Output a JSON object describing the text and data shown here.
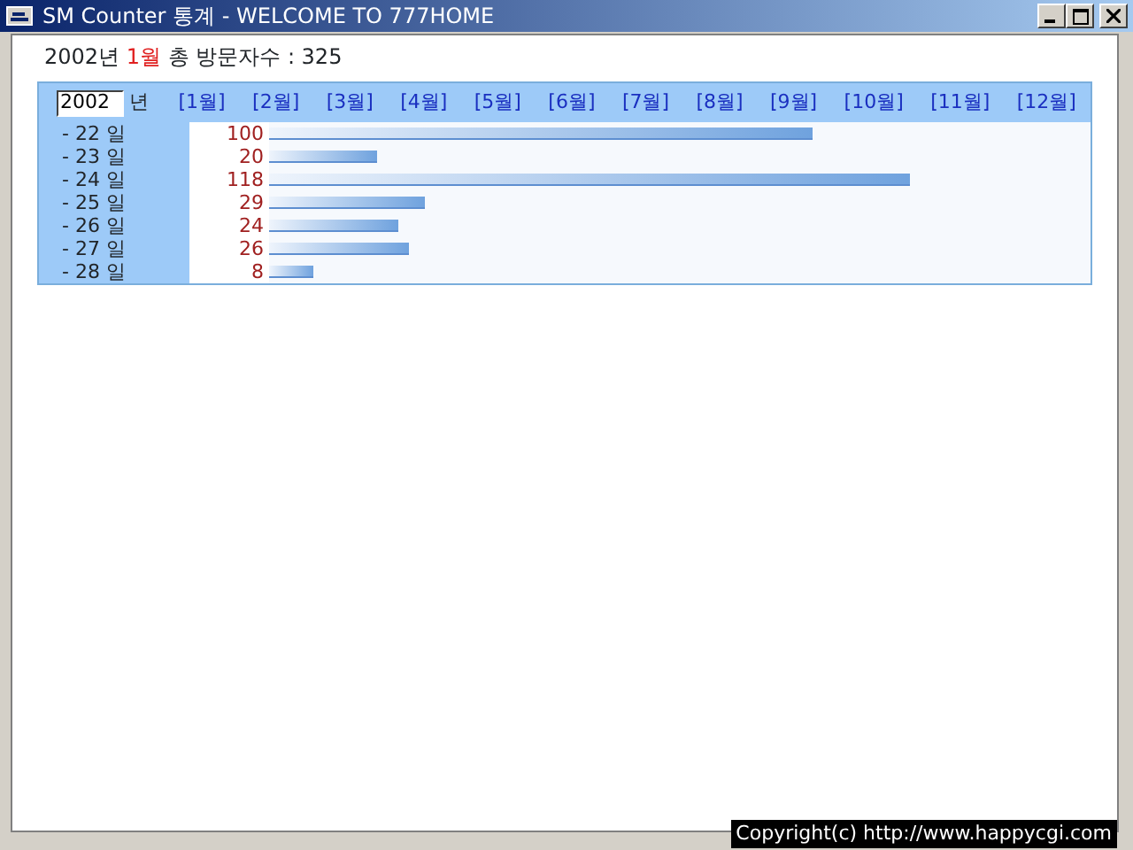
{
  "window": {
    "title": "SM Counter 통계 - WELCOME TO 777HOME"
  },
  "summary": {
    "year": "2002년",
    "month": "1월",
    "label": "총 방문자수 : 325"
  },
  "year_field": {
    "value": "2002",
    "unit": "년"
  },
  "months": [
    {
      "label": "[1월]"
    },
    {
      "label": "[2월]"
    },
    {
      "label": "[3월]"
    },
    {
      "label": "[4월]"
    },
    {
      "label": "[5월]"
    },
    {
      "label": "[6월]"
    },
    {
      "label": "[7월]"
    },
    {
      "label": "[8월]"
    },
    {
      "label": "[9월]"
    },
    {
      "label": "[10월]"
    },
    {
      "label": "[11월]"
    },
    {
      "label": "[12월]"
    }
  ],
  "days": [
    {
      "day": "- 22 일",
      "count": "100",
      "level": 0.662
    },
    {
      "day": "- 23 일",
      "count": "20",
      "level": 0.132
    },
    {
      "day": "- 24 일",
      "count": "118",
      "level": 0.78
    },
    {
      "day": "- 25 일",
      "count": "29",
      "level": 0.19
    },
    {
      "day": "- 26 일",
      "count": "24",
      "level": 0.158
    },
    {
      "day": "- 27 일",
      "count": "26",
      "level": 0.171
    },
    {
      "day": "- 28 일",
      "count": "8",
      "level": 0.053
    }
  ],
  "footer": {
    "copyright": "Copyright(c) http://www.happycgi.com"
  }
}
